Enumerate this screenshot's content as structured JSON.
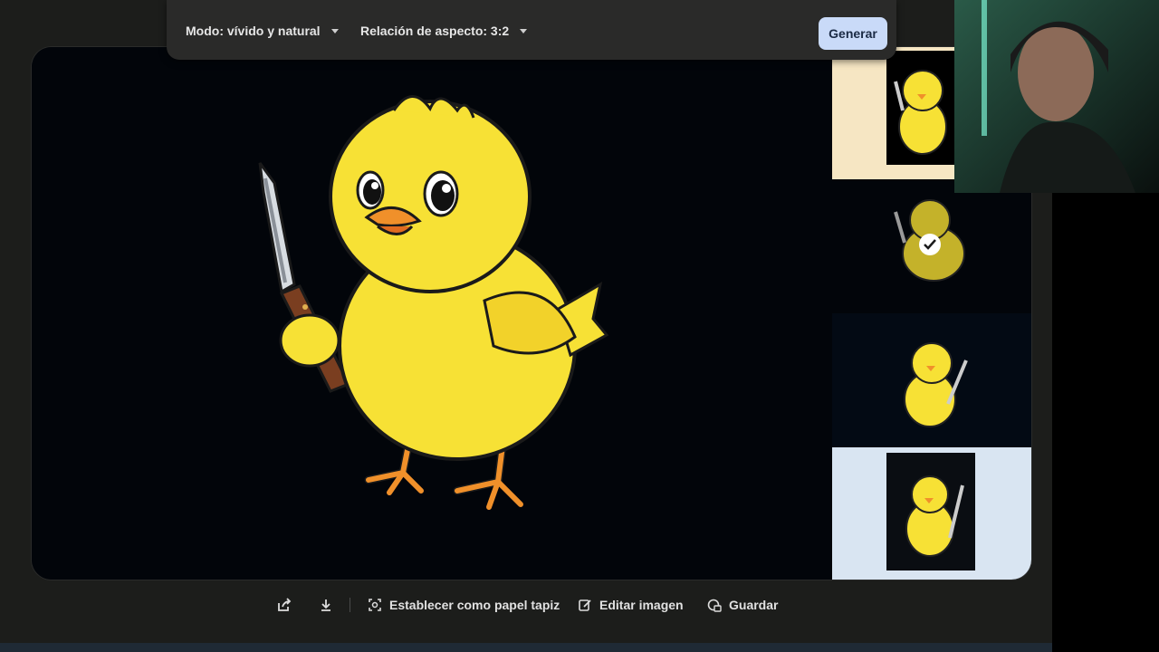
{
  "toolbar": {
    "mode_label": "Modo: vívido y natural",
    "aspect_label": "Relación de aspecto: 3:2",
    "generate_label": "Generar"
  },
  "actions": {
    "wallpaper_label": "Establecer como papel tapiz",
    "edit_label": "Editar imagen",
    "save_label": "Guardar"
  },
  "thumbnails": [
    {
      "state": "default"
    },
    {
      "state": "selected"
    },
    {
      "state": "default"
    },
    {
      "state": "default"
    }
  ],
  "icons": {
    "share": "share-icon",
    "download": "download-icon",
    "wallpaper": "wallpaper-icon",
    "edit": "edit-image-icon",
    "save": "save-icon",
    "check": "check-icon",
    "caret": "chevron-down-icon"
  },
  "colors": {
    "background": "#1c1d1b",
    "toolbar": "#2a2a29",
    "generate_button": "#c9daf8",
    "chick_yellow": "#f7e135",
    "beak_orange": "#f0902a"
  }
}
